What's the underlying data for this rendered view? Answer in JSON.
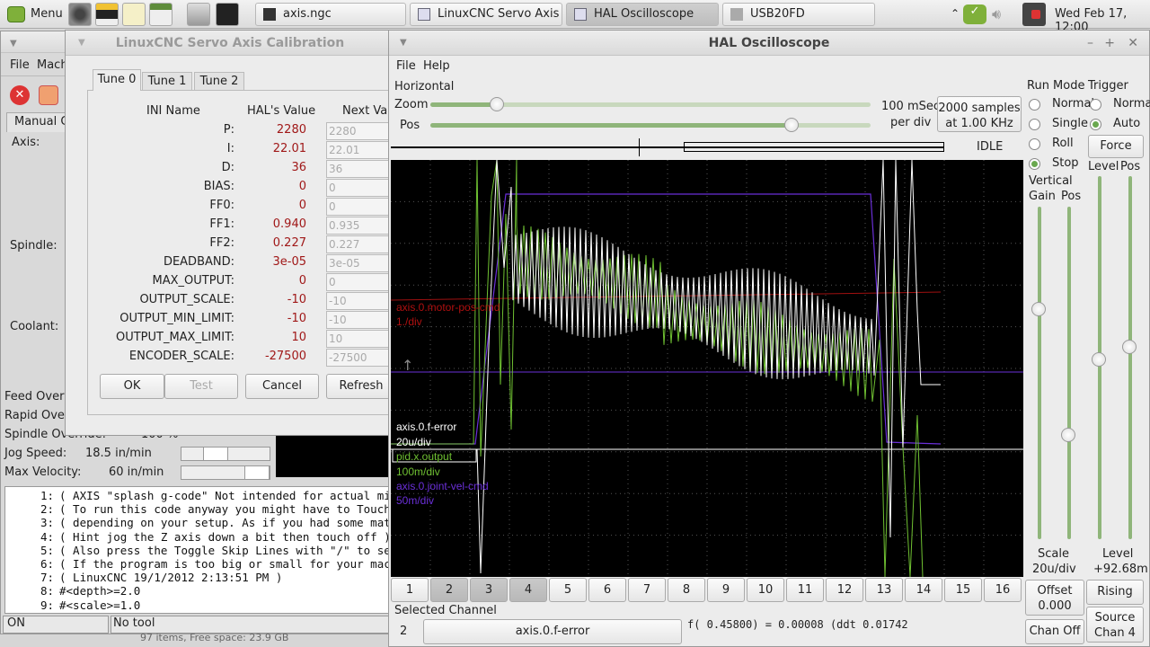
{
  "panel": {
    "menu_label": "Menu",
    "tasks": [
      "axis.ngc",
      "LinuxCNC Servo Axis ...",
      "HAL Oscilloscope",
      "USB20FD"
    ],
    "clock": "Wed Feb 17, 12:00"
  },
  "axis": {
    "menu": [
      "File",
      "Mach"
    ],
    "tab": "Manual Co",
    "labels": {
      "axis": "Axis:",
      "spindle": "Spindle:",
      "coolant": "Coolant:"
    },
    "overrides": [
      {
        "label": "Feed Overr"
      },
      {
        "label": "Rapid Over"
      },
      {
        "label": "Spindle Override:",
        "value": "100 %"
      },
      {
        "label": "Jog Speed:",
        "value": "18.5 in/min"
      },
      {
        "label": "Max Velocity:",
        "value": "60 in/min"
      }
    ],
    "gcode": [
      {
        "n": "1:",
        "t": "( AXIS \"splash g-code\" Not intended for actual millin"
      },
      {
        "n": "2:",
        "t": "( To run this code anyway you might have to Touch Off"
      },
      {
        "n": "3:",
        "t": "( depending on your setup. As if you had some materia"
      },
      {
        "n": "4:",
        "t": "( Hint jog the Z axis down a bit then touch off )"
      },
      {
        "n": "5:",
        "t": "( Also press the Toggle Skip Lines with \"/\" to see th"
      },
      {
        "n": "6:",
        "t": "( If the program is too big or small for your machine"
      },
      {
        "n": "7:",
        "t": "( LinuxCNC 19/1/2012 2:13:51 PM )"
      },
      {
        "n": "8:",
        "t": "#<depth>=2.0"
      },
      {
        "n": "9:",
        "t": "#<scale>=1.0"
      }
    ],
    "status": {
      "state": "ON",
      "tool": "No tool"
    },
    "filemgr_status": "97 items, Free space: 23.9 GB"
  },
  "calib": {
    "title": "LinuxCNC Servo Axis Calibration",
    "tabs": [
      "Tune 0",
      "Tune 1",
      "Tune 2"
    ],
    "headers": [
      "INI Name",
      "HAL's Value",
      "Next Val"
    ],
    "rows": [
      {
        "name": "P:",
        "hal": "2280",
        "next": "2280"
      },
      {
        "name": "I:",
        "hal": "22.01",
        "next": "22.01"
      },
      {
        "name": "D:",
        "hal": "36",
        "next": "36"
      },
      {
        "name": "BIAS:",
        "hal": "0",
        "next": "0"
      },
      {
        "name": "FF0:",
        "hal": "0",
        "next": "0"
      },
      {
        "name": "FF1:",
        "hal": "0.940",
        "next": "0.935"
      },
      {
        "name": "FF2:",
        "hal": "0.227",
        "next": "0.227"
      },
      {
        "name": "DEADBAND:",
        "hal": "3e-05",
        "next": "3e-05"
      },
      {
        "name": "MAX_OUTPUT:",
        "hal": "0",
        "next": "0"
      },
      {
        "name": "OUTPUT_SCALE:",
        "hal": "-10",
        "next": "-10"
      },
      {
        "name": "OUTPUT_MIN_LIMIT:",
        "hal": "-10",
        "next": "-10"
      },
      {
        "name": "OUTPUT_MAX_LIMIT:",
        "hal": "10",
        "next": "10"
      },
      {
        "name": "ENCODER_SCALE:",
        "hal": "-27500",
        "next": "-27500"
      }
    ],
    "buttons": [
      "OK",
      "Test",
      "Cancel",
      "Refresh"
    ]
  },
  "scope": {
    "title": "HAL Oscilloscope",
    "menu": [
      "File",
      "Help"
    ],
    "horizontal": "Horizontal",
    "zoom": "Zoom",
    "pos": "Pos",
    "zoom_level": 0.15,
    "pos_level": 0.82,
    "per_div": "100 mSec",
    "per_div2": "per div",
    "samples": "2000 samples",
    "rate": "at 1.00 KHz",
    "state": "IDLE",
    "run_mode": {
      "title": "Run Mode",
      "options": [
        "Normal",
        "Single",
        "Roll",
        "Stop"
      ],
      "selected": "Stop"
    },
    "trigger": {
      "title": "Trigger",
      "options": [
        "Normal",
        "Auto"
      ],
      "selected": "Auto",
      "force": "Force",
      "level": "Level",
      "pos": "Pos"
    },
    "vertical": {
      "title": "Vertical",
      "gain": "Gain",
      "pos": "Pos",
      "scale_label": "Scale",
      "scale_value": "20u/div",
      "level_label": "Level",
      "level_value": "+92.68m"
    },
    "offset": "Offset",
    "offset_value": "0.000",
    "rising": "Rising",
    "chan_off": "Chan Off",
    "source": "Source",
    "source_chan": "Chan 4",
    "channels": [
      "1",
      "2",
      "3",
      "4",
      "5",
      "6",
      "7",
      "8",
      "9",
      "10",
      "11",
      "12",
      "13",
      "14",
      "15",
      "16"
    ],
    "selected_channel_label": "Selected Channel",
    "selected_channel_num": "2",
    "selected_channel_name": "axis.0.f-error",
    "readout": "f( 0.45800) =  0.00008 (ddt  0.01742",
    "traces": [
      {
        "name": "axis.0.motor-pos-cmd",
        "scale": "1./div",
        "color": "#b01010"
      },
      {
        "name": "axis.0.f-error",
        "scale": "20u/div",
        "color": "#ffffff"
      },
      {
        "name": "pid.x.output",
        "scale": "100m/div",
        "color": "#6fc032"
      },
      {
        "name": "axis.0.joint-vel-cmd",
        "scale": "50m/div",
        "color": "#6a2fd8"
      }
    ]
  }
}
